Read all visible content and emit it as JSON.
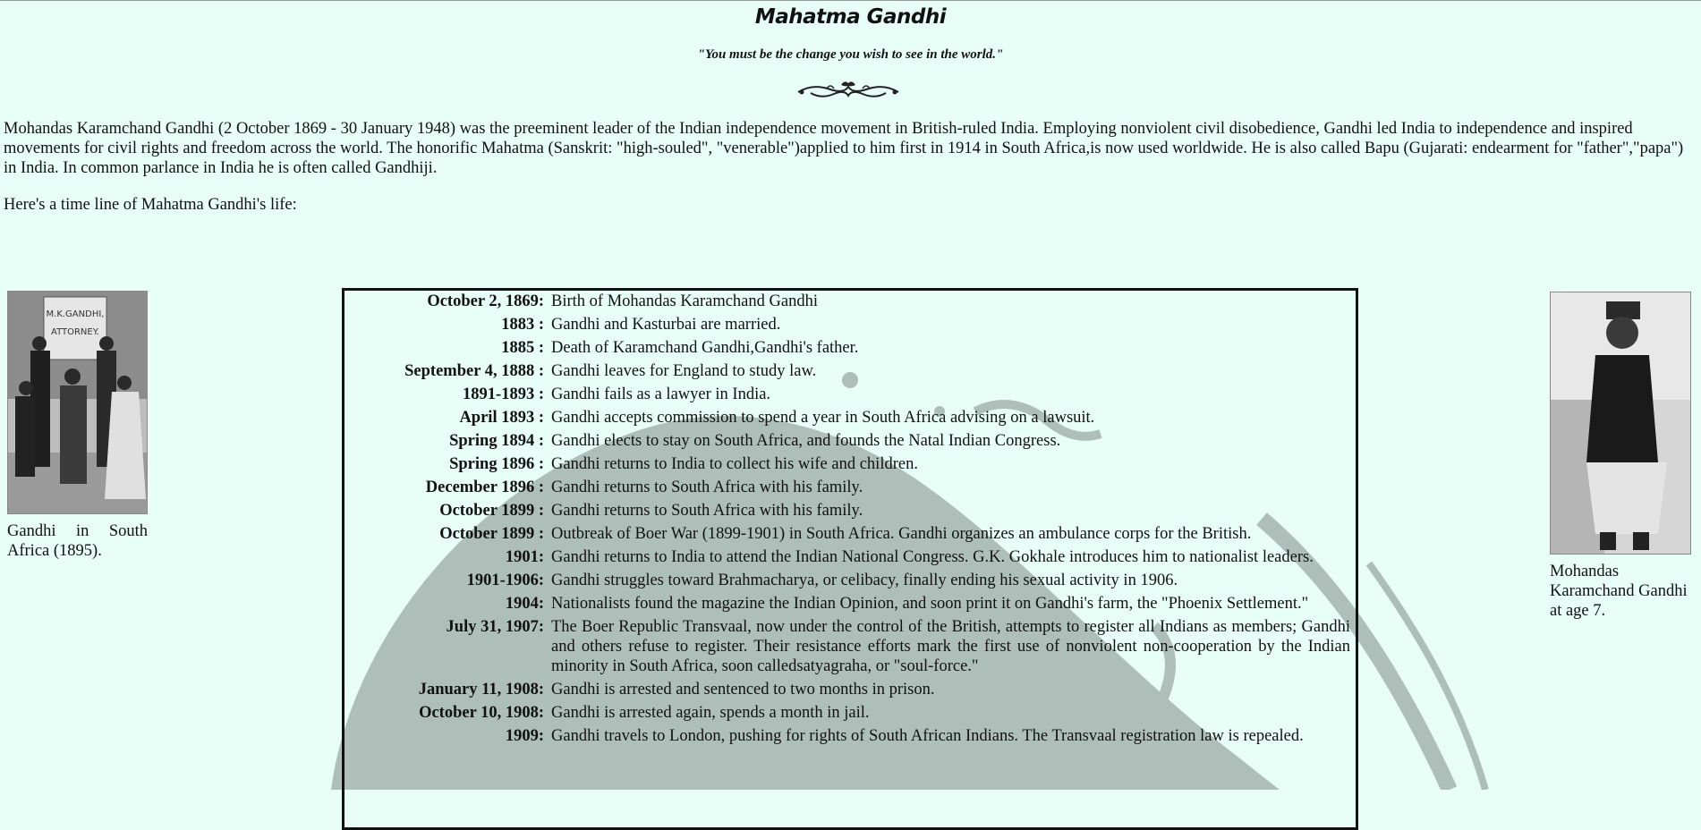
{
  "page": {
    "title": "Mahatma Gandhi",
    "quote": "\"You must be the change you wish to see in the world.\"",
    "ornament_icon": "ornamental-flourish",
    "intro": "Mohandas Karamchand Gandhi (2 October 1869 - 30 January 1948) was the preeminent leader of the Indian independence movement in British-ruled India. Employing nonviolent civil disobedience, Gandhi led India to independence and inspired movements for civil rights and freedom across the world. The honorific Mahatma (Sanskrit: \"high-souled\", \"venerable\")applied to him first in 1914 in South Africa,is now used worldwide. He is also called Bapu (Gujarati: endearment for \"father\",\"papa\") in India. In common parlance in India he is often called Gandhiji.",
    "timeline_intro": "Here's a time line of Mahatma Gandhi's life:"
  },
  "colors": {
    "background": "#e8fff8",
    "watermark": "#aebfba",
    "border": "#111111"
  },
  "figures": {
    "left": {
      "caption": "Gandhi in South Africa (1895).",
      "sign_line1": "M.K.GANDHI,",
      "sign_line2": "ATTORNEY."
    },
    "right": {
      "caption": "Mohandas Karamchand Gandhi at age 7."
    }
  },
  "timeline": [
    {
      "date": "October 2, 1869:",
      "event": "Birth of Mohandas Karamchand Gandhi"
    },
    {
      "date": "1883 :",
      "event": "Gandhi and Kasturbai are married."
    },
    {
      "date": "1885 :",
      "event": "Death of Karamchand Gandhi,Gandhi's father."
    },
    {
      "date": "September 4, 1888 :",
      "event": "Gandhi leaves for England to study law."
    },
    {
      "date": "1891-1893 :",
      "event": "Gandhi fails as a lawyer in India."
    },
    {
      "date": "April 1893 :",
      "event": "Gandhi accepts commission to spend a year in South Africa advising on a lawsuit."
    },
    {
      "date": "Spring 1894 :",
      "event": "Gandhi elects to stay on South Africa, and founds the Natal Indian Congress."
    },
    {
      "date": "Spring 1896 :",
      "event": "Gandhi returns to India to collect his wife and children."
    },
    {
      "date": "December 1896 :",
      "event": "Gandhi returns to South Africa with his family."
    },
    {
      "date": "October 1899 :",
      "event": "Gandhi returns to South Africa with his family."
    },
    {
      "date": "October 1899 :",
      "event": "Outbreak of Boer War (1899-1901) in South Africa. Gandhi organizes an ambulance corps for the British."
    },
    {
      "date": "1901:",
      "event": "Gandhi returns to India to attend the Indian National Congress. G.K. Gokhale introduces him to nationalist leaders."
    },
    {
      "date": "1901-1906:",
      "event": "Gandhi struggles toward Brahmacharya, or celibacy, finally ending his sexual activity in 1906."
    },
    {
      "date": "1904:",
      "event": "Nationalists found the magazine the Indian Opinion, and soon print it on Gandhi's farm, the \"Phoenix Settlement.\""
    },
    {
      "date": "July 31, 1907:",
      "event": "The Boer Republic Transvaal, now under the control of the British, attempts to register all Indians as members; Gandhi and others refuse to register. Their resistance efforts mark the first use of nonviolent non-cooperation by the Indian minority in South Africa, soon calledsatyagraha, or \"soul-force.\""
    },
    {
      "date": "January 11, 1908:",
      "event": "Gandhi is arrested and sentenced to two months in prison."
    },
    {
      "date": "October 10, 1908:",
      "event": "Gandhi is arrested again, spends a month in jail."
    },
    {
      "date": "1909:",
      "event": "Gandhi travels to London, pushing for rights of South African Indians. The Transvaal registration law is repealed."
    }
  ]
}
